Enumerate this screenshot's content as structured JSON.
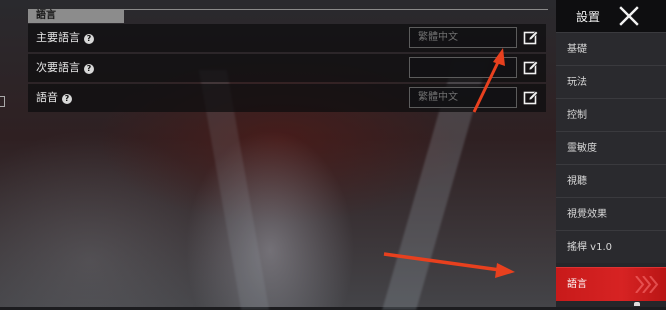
{
  "section": {
    "title": "語言"
  },
  "settings_rows": [
    {
      "label": "主要語言",
      "help": "?",
      "value": "繁體中文"
    },
    {
      "label": "次要語言",
      "help": "?",
      "value": ""
    },
    {
      "label": "語音",
      "help": "?",
      "value": "繁體中文"
    }
  ],
  "sidebar": {
    "title": "設置",
    "items": [
      {
        "label": "基礎"
      },
      {
        "label": "玩法"
      },
      {
        "label": "控制"
      },
      {
        "label": "靈敏度"
      },
      {
        "label": "視聽"
      },
      {
        "label": "視覺效果"
      },
      {
        "label": "搖桿 v1.0"
      },
      {
        "label": "語言",
        "active": true
      }
    ]
  },
  "colors": {
    "accent_red": "#d42020",
    "annotation_arrow": "#e8401e"
  },
  "icons": {
    "close": "close-x-icon",
    "edit": "edit-pencil-icon",
    "help": "help-circle-icon"
  }
}
